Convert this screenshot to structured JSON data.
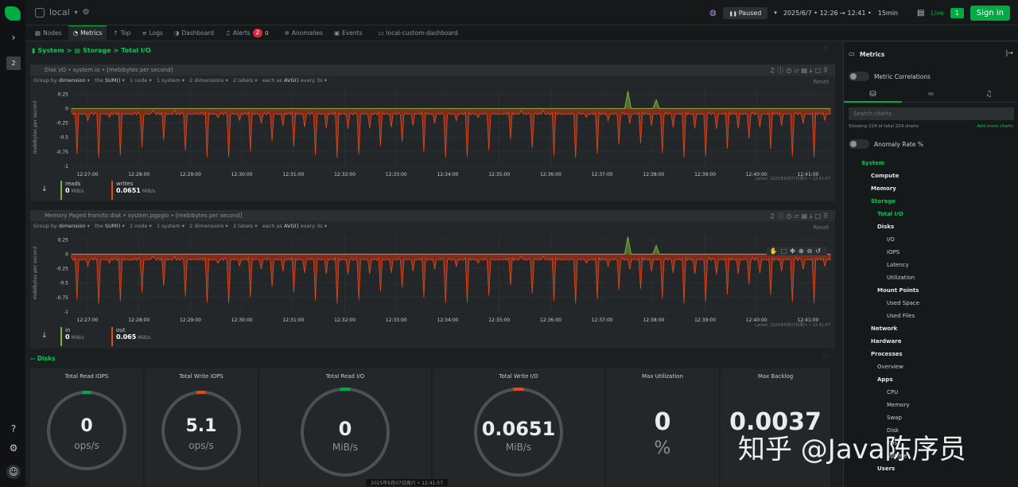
{
  "app": {
    "space": "local"
  },
  "rail": {
    "badge": "2"
  },
  "topbar": {
    "paused_label": "Paused",
    "date_range": "2025/6/7 • 12:26 → 12:41 •",
    "duration": "15min",
    "live_label": "Live",
    "live_count": "1",
    "signin_label": "Sign in"
  },
  "tabs": [
    {
      "label": "Nodes"
    },
    {
      "label": "Metrics"
    },
    {
      "label": "Top"
    },
    {
      "label": "Logs"
    },
    {
      "label": "Dashboard"
    },
    {
      "label": "Alerts",
      "badge": "2",
      "badge2": "0"
    },
    {
      "label": "Anomalies"
    },
    {
      "label": "Events"
    },
    {
      "label": "local-custom-dashboard"
    }
  ],
  "breadcrumb": {
    "system": "System",
    "storage": "Storage",
    "current": "Total I/O",
    "sep": ">"
  },
  "charts": [
    {
      "title": "Disk I/O • system.io • [mebibytes per second]",
      "ylabel": "mebibytes per second",
      "group_by": "Group by",
      "group_by_val": "dimension",
      "the_label": "the",
      "the_val": "SUM()",
      "nodes": "1 node",
      "systems": "1 system",
      "dims": "2 dimensions",
      "labels": "2 labels",
      "each_as": "each as",
      "agg": "AVG()",
      "every": "every 3s",
      "reset": "Reset",
      "latest": "Latest: 2025年6月07日周六 • 12:41:57",
      "legend": [
        {
          "name": "reads",
          "value": "0",
          "unit": "MiB/s",
          "color": "#7cb342"
        },
        {
          "name": "writes",
          "value": "0.0651",
          "unit": "MiB/s",
          "color": "#e64a19"
        }
      ]
    },
    {
      "title": "Memory Paged from/to disk • system.pgpgio • [mebibytes per second]",
      "ylabel": "mebibytes per second",
      "group_by": "Group by",
      "group_by_val": "dimension",
      "the_label": "the",
      "the_val": "SUM()",
      "nodes": "1 node",
      "systems": "1 system",
      "dims": "2 dimensions",
      "labels": "2 labels",
      "each_as": "each as",
      "agg": "AVG()",
      "every": "every 3s",
      "reset": "Reset",
      "latest": "Latest: 2025年6月07日周六 • 12:41:57",
      "legend": [
        {
          "name": "in",
          "value": "0",
          "unit": "MiB/s",
          "color": "#7cb342"
        },
        {
          "name": "out",
          "value": "0.065",
          "unit": "MiB/s",
          "color": "#e64a19"
        }
      ]
    }
  ],
  "chart_data": [
    {
      "type": "area",
      "ylabel": "mebibytes per second",
      "yticks": [
        "0.25",
        "0",
        "-0.25",
        "-0.5",
        "-0.75",
        "-1"
      ],
      "ylim": [
        -1,
        0.35
      ],
      "xticks": [
        "12:27:00",
        "12:28:00",
        "12:29:00",
        "12:30:00",
        "12:31:00",
        "12:32:00",
        "12:33:00",
        "12:34:00",
        "12:35:00",
        "12:36:00",
        "12:37:00",
        "12:38:00",
        "12:39:00",
        "12:40:00",
        "12:41:00"
      ],
      "series": [
        {
          "name": "reads",
          "color": "#7cb342",
          "peaks": [
            {
              "t": "12:37:30",
              "v": 0.3
            },
            {
              "t": "12:38:03",
              "v": 0.15
            }
          ]
        },
        {
          "name": "writes",
          "color": "#e64a19",
          "dips_min": -0.9
        }
      ]
    },
    {
      "type": "area",
      "ylabel": "mebibytes per second",
      "yticks": [
        "0.25",
        "0",
        "-0.25",
        "-0.5",
        "-0.75",
        "-1"
      ],
      "ylim": [
        -1,
        0.35
      ],
      "xticks": [
        "12:27:00",
        "12:28:00",
        "12:29:00",
        "12:30:00",
        "12:31:00",
        "12:32:00",
        "12:33:00",
        "12:34:00",
        "12:35:00",
        "12:36:00",
        "12:37:00",
        "12:38:00",
        "12:39:00",
        "12:40:00",
        "12:41:00"
      ],
      "series": [
        {
          "name": "in",
          "color": "#7cb342",
          "peaks": [
            {
              "t": "12:37:30",
              "v": 0.3
            },
            {
              "t": "12:38:03",
              "v": 0.15
            }
          ]
        },
        {
          "name": "out",
          "color": "#e64a19",
          "dips_min": -0.9
        }
      ]
    }
  ],
  "disks": {
    "label": "-- Disks",
    "gauges": [
      {
        "title": "Total Read IOPS",
        "value": "0",
        "unit": "ops/s",
        "indicator": "#00ab44"
      },
      {
        "title": "Total Write IOPS",
        "value": "5.1",
        "unit": "ops/s",
        "indicator": "#e64a19"
      },
      {
        "title": "Total Read I/O",
        "value": "0",
        "unit": "MiB/s",
        "indicator": "#00ab44"
      },
      {
        "title": "Total Write I/O",
        "value": "0.0651",
        "unit": "MiB/s",
        "indicator": "#e64a19"
      },
      {
        "title": "Max Utilization",
        "value": "0",
        "unit": "%"
      },
      {
        "title": "Max Backlog",
        "value": "0.0037",
        "unit": ""
      }
    ]
  },
  "bottom_time": "2025年6月07日周六 • 12:41:57",
  "right_panel": {
    "title": "Metrics",
    "metric_correlations": "Metric Correlations",
    "search_placeholder": "Search charts",
    "showing": "Showing 224 of total 224 charts",
    "add_more": "Add more charts",
    "anomaly_rate": "Anomaly Rate %",
    "tree": [
      {
        "label": "System",
        "indent": 0,
        "style": "g"
      },
      {
        "label": "Compute",
        "indent": 1,
        "style": "b"
      },
      {
        "label": "Memory",
        "indent": 1,
        "style": "b"
      },
      {
        "label": "Storage",
        "indent": 1,
        "style": "g"
      },
      {
        "label": "Total I/O",
        "indent": 2,
        "style": "g"
      },
      {
        "label": "Disks",
        "indent": 2,
        "style": "b"
      },
      {
        "label": "I/O",
        "indent": 3,
        "style": ""
      },
      {
        "label": "IOPS",
        "indent": 3,
        "style": ""
      },
      {
        "label": "Latency",
        "indent": 3,
        "style": ""
      },
      {
        "label": "Utilization",
        "indent": 3,
        "style": ""
      },
      {
        "label": "Mount Points",
        "indent": 2,
        "style": "b"
      },
      {
        "label": "Used Space",
        "indent": 3,
        "style": ""
      },
      {
        "label": "Used Files",
        "indent": 3,
        "style": ""
      },
      {
        "label": "Network",
        "indent": 1,
        "style": "b"
      },
      {
        "label": "Hardware",
        "indent": 1,
        "style": "b"
      },
      {
        "label": "Processes",
        "indent": 1,
        "style": "b"
      },
      {
        "label": "Overview",
        "indent": 2,
        "style": ""
      },
      {
        "label": "Apps",
        "indent": 2,
        "style": "b"
      },
      {
        "label": "CPU",
        "indent": 3,
        "style": ""
      },
      {
        "label": "Memory",
        "indent": 3,
        "style": ""
      },
      {
        "label": "Swap",
        "indent": 3,
        "style": ""
      },
      {
        "label": "Disk",
        "indent": 3,
        "style": ""
      },
      {
        "label": "FDs",
        "indent": 3,
        "style": ""
      },
      {
        "label": "Uptime",
        "indent": 3,
        "style": ""
      },
      {
        "label": "Users",
        "indent": 2,
        "style": "b"
      }
    ]
  },
  "watermark": "知乎 @Java陈序员"
}
